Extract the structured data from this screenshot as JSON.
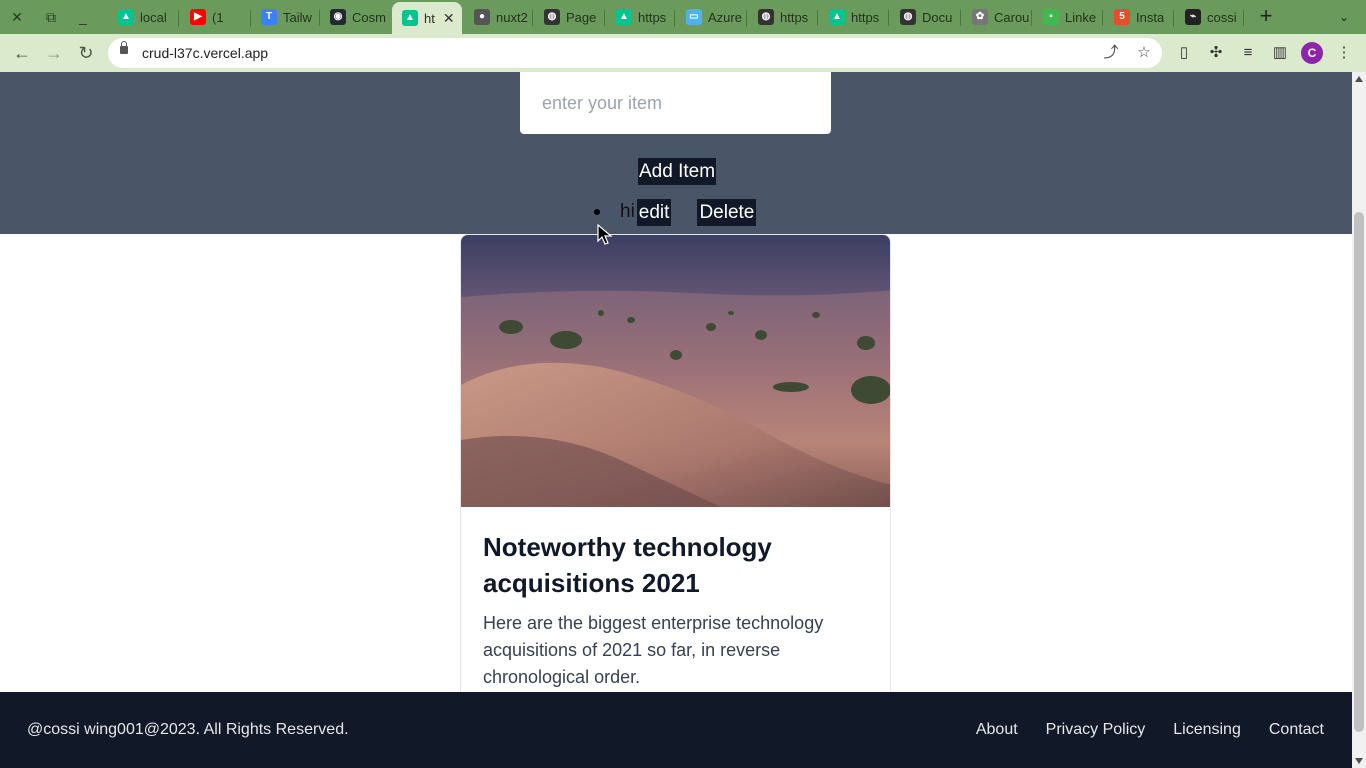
{
  "browser": {
    "tabs": [
      {
        "title": "local",
        "icon": "nuxt-icon",
        "color": "#00c58e"
      },
      {
        "title": "(1",
        "icon": "youtube-icon",
        "color": "#ff0000"
      },
      {
        "title": "Tailw",
        "icon": "tailwind-icon",
        "color": "#3b82f6"
      },
      {
        "title": "Cosm",
        "icon": "github-icon",
        "color": "#24292f"
      },
      {
        "title": "ht",
        "icon": "nuxt-icon",
        "color": "#00c58e",
        "active": true
      },
      {
        "title": "nuxt2",
        "icon": "avatar-icon",
        "color": "#555555"
      },
      {
        "title": "Page",
        "icon": "globe-icon",
        "color": "#333333"
      },
      {
        "title": "https",
        "icon": "nuxt-icon",
        "color": "#00c58e"
      },
      {
        "title": "Azure",
        "icon": "folder-icon",
        "color": "#4fb3e8"
      },
      {
        "title": "https",
        "icon": "globe-icon",
        "color": "#333333"
      },
      {
        "title": "https",
        "icon": "nuxt-icon",
        "color": "#00c58e"
      },
      {
        "title": "Docu",
        "icon": "globe-icon",
        "color": "#333333"
      },
      {
        "title": "Carou",
        "icon": "openai-icon",
        "color": "#777777"
      },
      {
        "title": "Linke",
        "icon": "linkedin-icon",
        "color": "#3fb950"
      },
      {
        "title": "Insta",
        "icon": "html5-icon",
        "color": "#e34f26"
      },
      {
        "title": "cossi",
        "icon": "terminal-icon",
        "color": "#222222"
      }
    ],
    "url": "crud-l37c.vercel.app",
    "profile_initial": "C"
  },
  "form": {
    "input_placeholder": "enter your item",
    "add_button": "Add Item"
  },
  "items": [
    {
      "text": "hi",
      "edit_label": "edit",
      "delete_label": "Delete"
    }
  ],
  "card": {
    "title": "Noteworthy technology acquisitions 2021",
    "description": "Here are the biggest enterprise technology acquisitions of 2021 so far, in reverse chronological order."
  },
  "footer": {
    "copyright": "@cossi wing001@2023. All Rights Reserved.",
    "links": [
      "About",
      "Privacy Policy",
      "Licensing",
      "Contact"
    ]
  }
}
